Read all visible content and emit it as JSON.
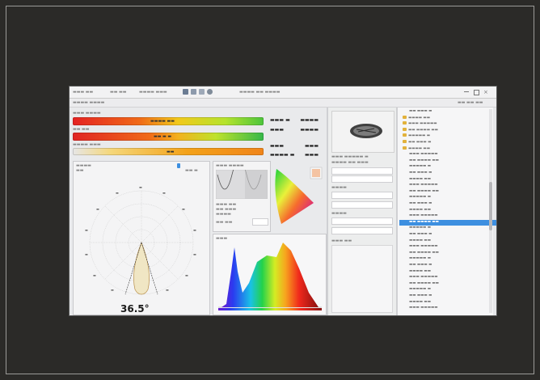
{
  "beam": {
    "angle_label": "36.5°"
  },
  "colors": {
    "screen_bg": "#e6e7e9",
    "selection": "#3d8fe0",
    "folder": "#e2b23c",
    "desk": "#2b2a28"
  },
  "tree": {
    "item_count": 33,
    "selected_index": 18,
    "folder_indices": [
      1,
      2,
      3,
      4,
      5,
      6
    ]
  }
}
